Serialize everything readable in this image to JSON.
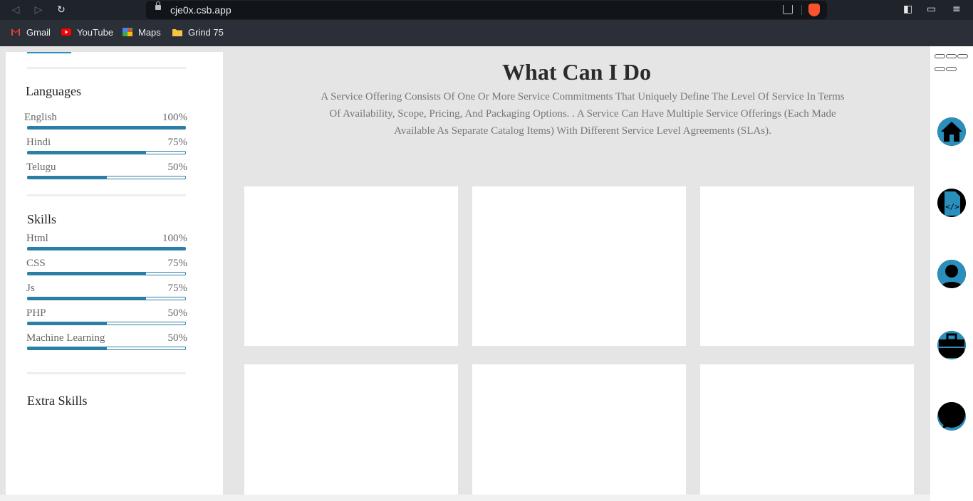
{
  "browser": {
    "url": "cje0x.csb.app",
    "bookmarks": [
      {
        "label": "Gmail",
        "icon": "gmail-icon"
      },
      {
        "label": "YouTube",
        "icon": "youtube-icon"
      },
      {
        "label": "Maps",
        "icon": "maps-icon"
      },
      {
        "label": "Grind 75",
        "icon": "folder-icon"
      }
    ]
  },
  "sidebar": {
    "languages": {
      "title": "Languages",
      "items": [
        {
          "label": "English",
          "percent": "100%",
          "level": 1.0
        },
        {
          "label": "Hindi",
          "percent": "75%",
          "level": 0.75
        },
        {
          "label": "Telugu",
          "percent": "50%",
          "level": 0.5
        }
      ]
    },
    "skills": {
      "title": "Skills",
      "items": [
        {
          "label": "Html",
          "percent": "100%",
          "level": 1.0
        },
        {
          "label": "CSS",
          "percent": "75%",
          "level": 0.75
        },
        {
          "label": "Js",
          "percent": "75%",
          "level": 0.75
        },
        {
          "label": "PHP",
          "percent": "50%",
          "level": 0.5
        },
        {
          "label": "Machine Learning",
          "percent": "50%",
          "level": 0.5
        }
      ]
    },
    "extra_skills": {
      "title": "Extra Skills"
    }
  },
  "main": {
    "heading": "What Can I Do",
    "description": "A Service Offering Consists Of One Or More Service Commitments That Uniquely Define The Level Of Service In Terms Of Availability, Scope, Pricing, And Packaging Options. . A Service Can Have Multiple Service Offerings (Each Made Available As Separate Catalog Items) With Different Service Level Agreements (SLAs)."
  },
  "right_nav": {
    "items": [
      "home-icon",
      "code-file-icon",
      "user-icon",
      "briefcase-icon",
      "chat-icon"
    ]
  },
  "colors": {
    "accent": "#2a8fbd",
    "page_bg": "#e5e5e5",
    "chrome_bg": "#1f232a"
  }
}
